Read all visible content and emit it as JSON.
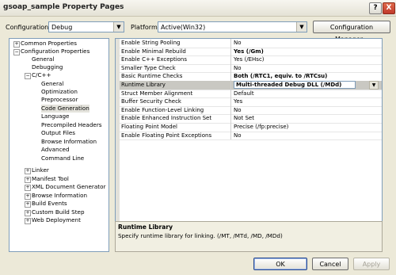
{
  "window": {
    "title": "gsoap_sample Property Pages",
    "help_label": "?",
    "close_label": "X"
  },
  "toolbar": {
    "configuration_label": "Configuration:",
    "configuration_value": "Debug",
    "platform_label": "Platform:",
    "platform_value": "Active(Win32)",
    "config_manager_label": "Configuration Manager..."
  },
  "tree": {
    "items": [
      {
        "label": "Common Properties"
      },
      {
        "label": "Configuration Properties"
      },
      {
        "label": "General"
      },
      {
        "label": "Debugging"
      },
      {
        "label": "C/C++"
      },
      {
        "label": "General"
      },
      {
        "label": "Optimization"
      },
      {
        "label": "Preprocessor"
      },
      {
        "label": "Code Generation"
      },
      {
        "label": "Language"
      },
      {
        "label": "Precompiled Headers"
      },
      {
        "label": "Output Files"
      },
      {
        "label": "Browse Information"
      },
      {
        "label": "Advanced"
      },
      {
        "label": "Command Line"
      },
      {
        "label": "Linker"
      },
      {
        "label": "Manifest Tool"
      },
      {
        "label": "XML Document Generator"
      },
      {
        "label": "Browse Information"
      },
      {
        "label": "Build Events"
      },
      {
        "label": "Custom Build Step"
      },
      {
        "label": "Web Deployment"
      }
    ]
  },
  "grid": {
    "rows": [
      {
        "name": "Enable String Pooling",
        "value": "No"
      },
      {
        "name": "Enable Minimal Rebuild",
        "value": "Yes (/Gm)"
      },
      {
        "name": "Enable C++ Exceptions",
        "value": "Yes (/EHsc)"
      },
      {
        "name": "Smaller Type Check",
        "value": "No"
      },
      {
        "name": "Basic Runtime Checks",
        "value": "Both (/RTC1, equiv. to /RTCsu)"
      },
      {
        "name": "Runtime Library",
        "value": "Multi-threaded Debug DLL (/MDd)"
      },
      {
        "name": "Struct Member Alignment",
        "value": "Default"
      },
      {
        "name": "Buffer Security Check",
        "value": "Yes"
      },
      {
        "name": "Enable Function-Level Linking",
        "value": "No"
      },
      {
        "name": "Enable Enhanced Instruction Set",
        "value": "Not Set"
      },
      {
        "name": "Floating Point Model",
        "value": "Precise (/fp:precise)"
      },
      {
        "name": "Enable Floating Point Exceptions",
        "value": "No"
      }
    ]
  },
  "description": {
    "title": "Runtime Library",
    "text": "Specify runtime library for linking.     (/MT, /MTd, /MD, /MDd)"
  },
  "buttons": {
    "ok": "OK",
    "cancel": "Cancel",
    "apply": "Apply"
  }
}
